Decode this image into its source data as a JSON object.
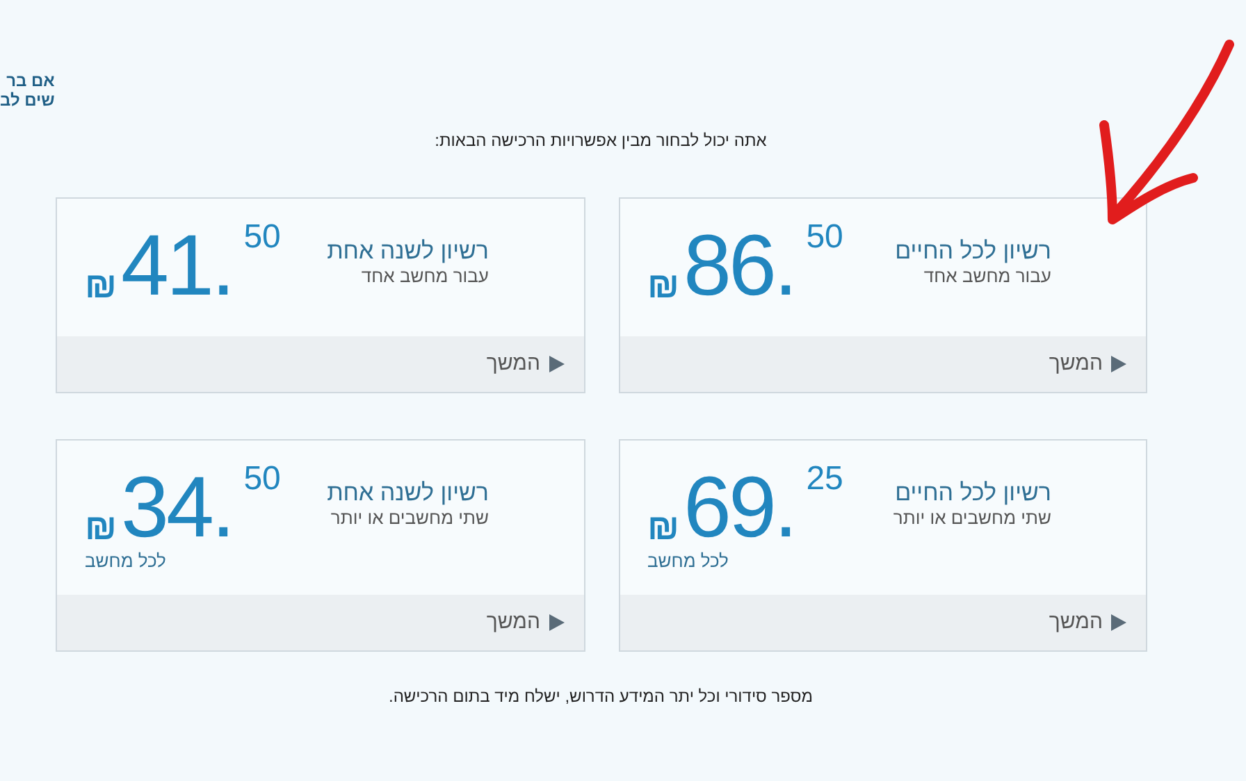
{
  "notice_lines": [
    "אם בר",
    "שים לב"
  ],
  "intro": "אתה יכול לבחור מבין אפשרויות הרכישה הבאות:",
  "plans": [
    {
      "title": "רשיון לכל החיים",
      "subtitle": "עבור מחשב אחד",
      "price_whole": "86.",
      "price_cents": "50",
      "currency": "₪",
      "button": "המשך"
    },
    {
      "title": "רשיון לשנה אחת",
      "subtitle": "עבור מחשב אחד",
      "price_whole": "41.",
      "price_cents": "50",
      "currency": "₪",
      "button": "המשך"
    },
    {
      "title": "רשיון לכל החיים",
      "subtitle": "שתי מחשבים או יותר",
      "price_whole": "69.",
      "price_cents": "25",
      "currency": "₪",
      "note": "לכל מחשב",
      "button": "המשך"
    },
    {
      "title": "רשיון לשנה אחת",
      "subtitle": "שתי מחשבים או יותר",
      "price_whole": "34.",
      "price_cents": "50",
      "currency": "₪",
      "note": "לכל מחשב",
      "button": "המשך"
    }
  ],
  "footer": "מספר סידורי וכל יתר המידע הדרוש, ישלח מיד בתום הרכישה."
}
